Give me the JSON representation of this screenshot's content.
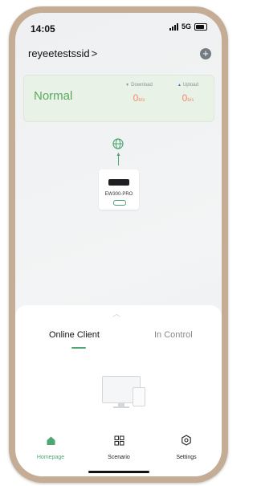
{
  "statusbar": {
    "time": "14:05",
    "network": "5G"
  },
  "header": {
    "ssid": "reyeetestssid",
    "chevron": ">",
    "add_icon": "plus-circle-icon"
  },
  "status_card": {
    "status": "Normal",
    "download": {
      "label": "Download",
      "value": "0",
      "unit": "b/s"
    },
    "upload": {
      "label": "Upload",
      "value": "0",
      "unit": "b/s"
    }
  },
  "topology": {
    "internet_icon": "globe-icon",
    "device_name": "EW300-PRO"
  },
  "tabs": [
    {
      "label": "Online Client"
    },
    {
      "label": "In Control"
    }
  ],
  "navbar": [
    {
      "label": "Homepage",
      "icon": "home-icon"
    },
    {
      "label": "Scenario",
      "icon": "grid-icon"
    },
    {
      "label": "Settings",
      "icon": "gear-icon"
    }
  ],
  "colors": {
    "accent": "#4fa573",
    "normal": "#5ca85f",
    "speed": "#f08a6a",
    "frame": "#c4ad94"
  }
}
